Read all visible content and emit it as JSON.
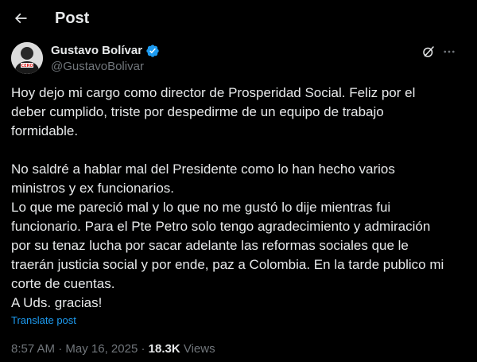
{
  "header": {
    "title": "Post",
    "back_icon": "arrow-left-icon"
  },
  "author": {
    "name": "Gustavo Bolívar",
    "handle": "@GustavoBolivar",
    "verified": true,
    "verified_color": "#1d9bf0",
    "avatar_text": "CERO"
  },
  "actions": {
    "grok_icon": "grok-icon",
    "more_icon": "more-horizontal-icon"
  },
  "post": {
    "lines": [
      "Hoy dejo mi cargo como director de Prosperidad Social. Feliz por el",
      "deber cumplido, triste por despedirme de un equipo de trabajo",
      "formidable.",
      "",
      "No saldré a hablar mal del Presidente como lo han hecho varios",
      "ministros y ex funcionarios.",
      "Lo que me pareció mal y lo que no me gustó lo dije mientras fui",
      "funcionario. Para el Pte Petro solo tengo agradecimiento y admiración",
      "por su tenaz lucha por sacar adelante las reformas sociales que le",
      "traerán justicia social y por ende, paz a Colombia. En la tarde publico mi",
      "corte de cuentas.",
      "A Uds. gracias!"
    ],
    "translate_label": "Translate post"
  },
  "meta": {
    "time": "8:57 AM",
    "separator1": " · ",
    "date": "May 16, 2025",
    "separator2": " · ",
    "views_count": "18.3K",
    "views_label": " Views"
  },
  "colors": {
    "background": "#000000",
    "text": "#e7e9ea",
    "secondary": "#71767b",
    "accent": "#1d9bf0"
  }
}
